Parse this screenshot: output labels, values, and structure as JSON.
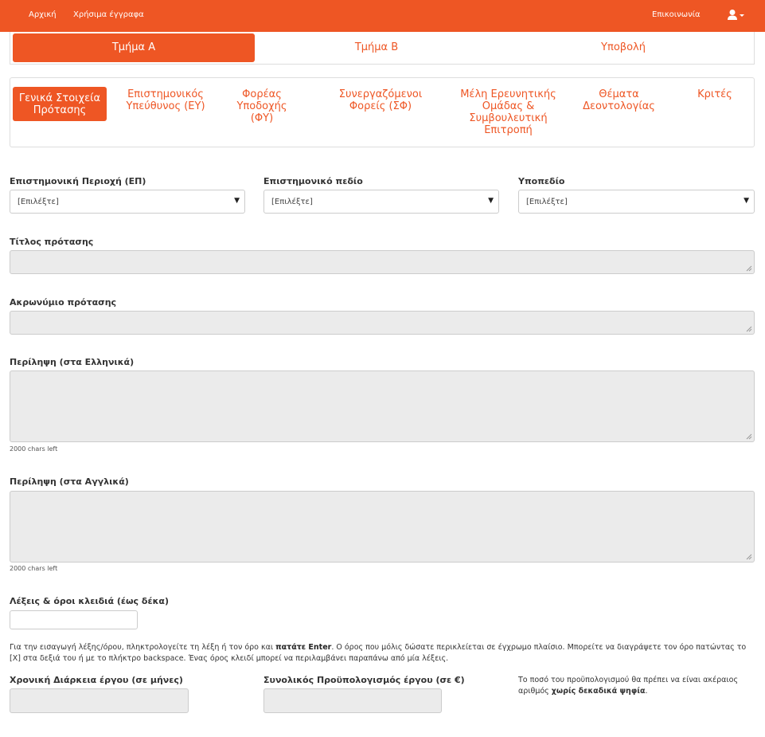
{
  "nav": {
    "home": "Αρχική",
    "docs": "Χρήσιμα έγγραφα",
    "contact": "Επικοινωνία"
  },
  "sections": {
    "a": "Τμήμα Α",
    "b": "Τμήμα Β",
    "submit": "Υποβολή"
  },
  "subtabs": {
    "general_line1": "Γενικά Στοιχεία",
    "general_line2": "Πρότασης",
    "sci_resp_line1": "Επιστημονικός",
    "sci_resp_line2": "Υπεύθυνος (ΕΥ)",
    "host_line1": "Φορέας",
    "host_line2": "Υποδοχής",
    "host_line3": "(ΦΥ)",
    "partners_line1": "Συνεργαζόμενοι",
    "partners_line2": "Φορείς (ΣΦ)",
    "team_line1": "Μέλη Ερευνητικής",
    "team_line2": "Ομάδας &",
    "team_line3": "Συμβουλευτική",
    "team_line4": "Επιτροπή",
    "ethics_line1": "Θέματα",
    "ethics_line2": "Δεοντολογίας",
    "reviewers": "Κριτές"
  },
  "form": {
    "sci_area_label": "Επιστημονική Περιοχή (ΕΠ)",
    "sci_area_value": "[Επιλέξτε]",
    "sci_field_label": "Επιστημονικό πεδίο",
    "sci_field_value": "[Επιλέξτε]",
    "subfield_label": "Υποπεδίο",
    "subfield_value": "[Επιλέξτε]",
    "title_label": "Τίτλος πρότασης",
    "acronym_label": "Ακρωνύμιο πρότασης",
    "abstract_el_label": "Περίληψη (στα Ελληνικά)",
    "abstract_el_counter": "2000 chars left",
    "abstract_en_label": "Περίληψη (στα Αγγλικά)",
    "abstract_en_counter": "2000 chars left",
    "keywords_label": "Λέξεις & όροι κλειδιά (έως δέκα)",
    "keywords_help_1": "Για την εισαγωγή λέξης/όρου, πληκτρολογείτε τη λέξη ή τον όρο και ",
    "keywords_help_bold": "πατάτε Enter",
    "keywords_help_2": ". Ο όρος που μόλις δώσατε περικλείεται σε έγχρωμο πλαίσιο. Μπορείτε να διαγράψετε τον όρο πατώντας το [X] στα δεξιά του ή με το πλήκτρο backspace. Ένας όρος κλειδί μπορεί να περιλαμβάνει παραπάνω από μία λέξεις.",
    "duration_label": "Χρονική Διάρκεια έργου (σε μήνες)",
    "budget_label": "Συνολικός Προϋπολογισμός έργου (σε €)",
    "budget_note_1": "Το ποσό του προϋπολογισμού θα πρέπει να είναι ακέραιος αριθμός ",
    "budget_note_bold": "χωρίς δεκαδικά ψηφία",
    "budget_note_2": "."
  },
  "colors": {
    "accent": "#ee5624",
    "field_bg": "#ebebeb"
  }
}
